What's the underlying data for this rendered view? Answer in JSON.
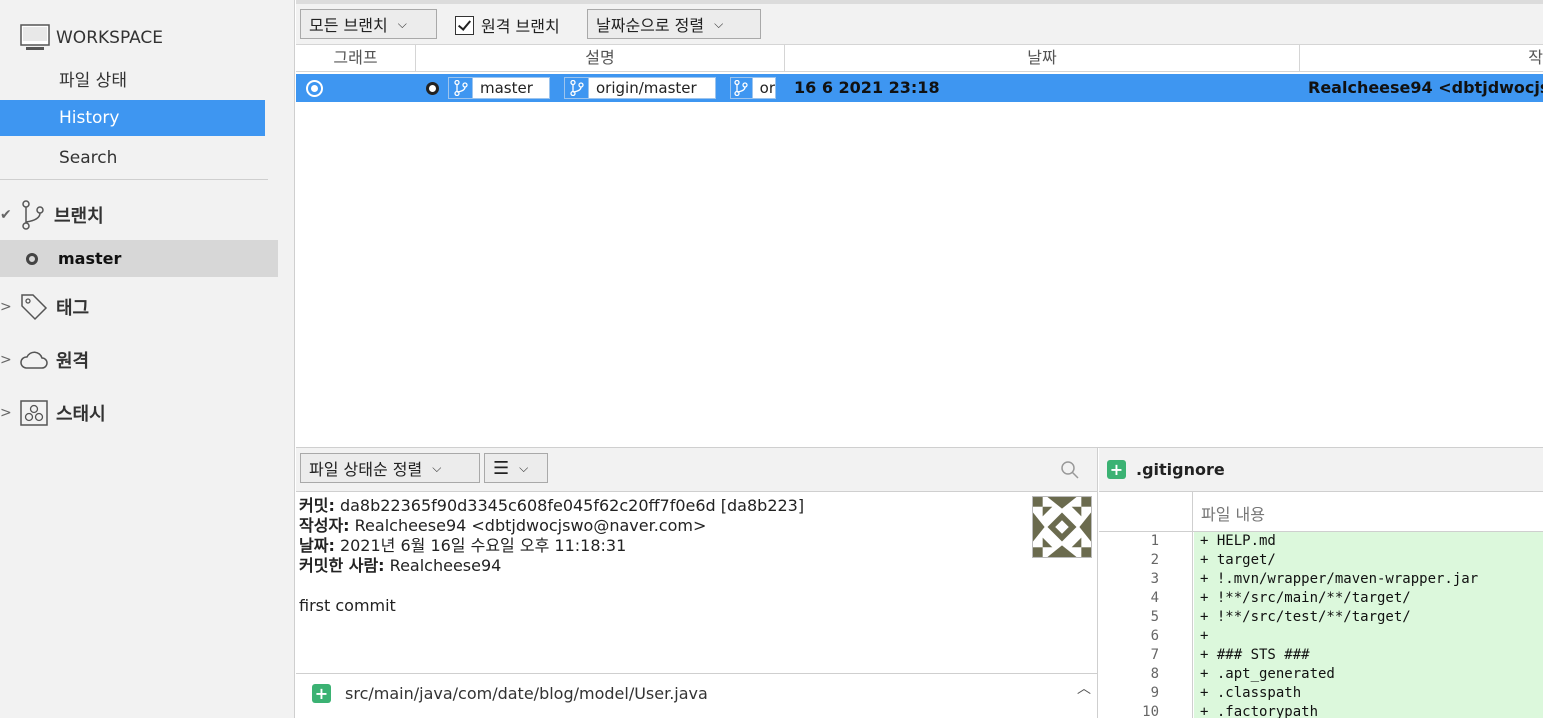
{
  "sidebar": {
    "workspace_label": "WORKSPACE",
    "nav": [
      "파일 상태",
      "History",
      "Search"
    ],
    "active_nav": "History",
    "sections": {
      "branches": "브랜치",
      "tags": "태그",
      "remotes": "원격",
      "stashes": "스태시"
    },
    "branch_items": [
      "master"
    ]
  },
  "toolbar": {
    "branch_filter": "모든 브랜치",
    "remote_branches_label": "원격 브랜치",
    "remote_branches_checked": true,
    "sort_order": "날짜순으로 정렬"
  },
  "history": {
    "columns": [
      "그래프",
      "설명",
      "날짜",
      "작"
    ],
    "rows": [
      {
        "refs": [
          "master",
          "origin/master",
          "or"
        ],
        "date": "16 6 2021 23:18",
        "author": "Realcheese94 <dbtjdwocjsw"
      }
    ]
  },
  "lower": {
    "file_sort": "파일 상태순 정렬",
    "view_mode_icon": "list-icon"
  },
  "commit": {
    "hash_label": "커밋:",
    "hash_value": "da8b22365f90d3345c608fe045f62c20ff7f0e6d [da8b223]",
    "author_label": "작성자:",
    "author_value": "Realcheese94 <dbtjdwocjswo@naver.com>",
    "date_label": "날짜:",
    "date_value": "2021년 6월 16일 수요일 오후 11:18:31",
    "committer_label": "커밋한 사람:",
    "committer_value": "Realcheese94",
    "message": "first commit"
  },
  "files": [
    "src/main/java/com/date/blog/model/User.java"
  ],
  "diff": {
    "file_name": ".gitignore",
    "header_label": "파일 내용",
    "lines": [
      {
        "n": "1",
        "text": "+ HELP.md"
      },
      {
        "n": "2",
        "text": "+ target/"
      },
      {
        "n": "3",
        "text": "+ !.mvn/wrapper/maven-wrapper.jar"
      },
      {
        "n": "4",
        "text": "+ !**/src/main/**/target/"
      },
      {
        "n": "5",
        "text": "+ !**/src/test/**/target/"
      },
      {
        "n": "6",
        "text": "+"
      },
      {
        "n": "7",
        "text": "+ ### STS ###"
      },
      {
        "n": "8",
        "text": "+ .apt_generated"
      },
      {
        "n": "9",
        "text": "+ .classpath"
      },
      {
        "n": "10",
        "text": "+ .factorypath"
      }
    ]
  },
  "colors": {
    "accent": "#3e96f1",
    "added_bg": "#dcf8dc",
    "add_icon": "#3bb273"
  }
}
